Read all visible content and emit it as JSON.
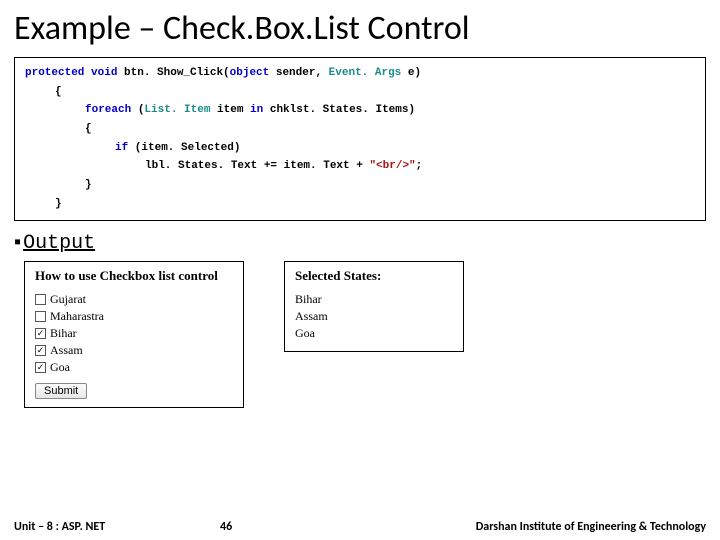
{
  "title": "Example – Check.Box.List Control",
  "code": {
    "l1a": "protected void",
    "l1b": " btn. Show_Click(",
    "l1c": "object",
    "l1d": " sender, ",
    "l1e": "Event. Args",
    "l1f": " e)",
    "l2": "{",
    "l3a": "foreach",
    "l3b": " (",
    "l3c": "List. Item",
    "l3d": " item ",
    "l3e": "in",
    "l3f": " chklst. States. Items)",
    "l4": "{",
    "l5a": "if",
    "l5b": " (item. Selected)",
    "l6a": "lbl. States. Text += item. Text + ",
    "l6b": "\"<br/>\"",
    "l6c": ";",
    "l7": "}",
    "l8": "}"
  },
  "output_heading": "Output",
  "left_panel_title": "How to use Checkbox list control",
  "states": [
    {
      "name": "Gujarat",
      "checked": false
    },
    {
      "name": "Maharastra",
      "checked": false
    },
    {
      "name": "Bihar",
      "checked": true
    },
    {
      "name": "Assam",
      "checked": true
    },
    {
      "name": "Goa",
      "checked": true
    }
  ],
  "submit_label": "Submit",
  "right_panel_title": "Selected States:",
  "selected": [
    "Bihar",
    "Assam",
    "Goa"
  ],
  "footer": {
    "left": "Unit – 8 : ASP. NET",
    "center": "46",
    "right": "Darshan Institute of Engineering & Technology"
  }
}
